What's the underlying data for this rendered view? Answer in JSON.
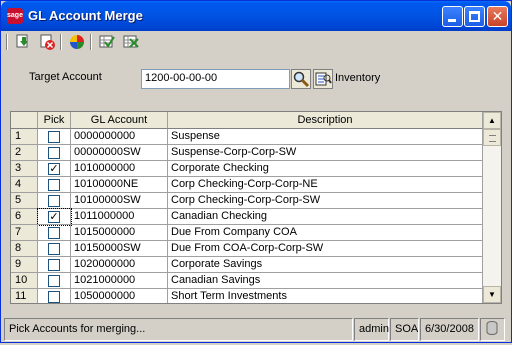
{
  "window": {
    "title": "GL Account Merge",
    "app_icon_text": "sage",
    "close_glyph": "✕"
  },
  "toolbar": {
    "icons": [
      "import-icon",
      "delete-icon",
      "color-wheel-icon",
      "grid-check-icon",
      "grid-x-icon"
    ]
  },
  "form": {
    "target_account_label": "Target Account",
    "target_account_value": "1200-00-00-00",
    "target_account_description": "Inventory"
  },
  "grid": {
    "headers": {
      "row": "",
      "pick": "Pick",
      "account": "GL Account",
      "description": "Description"
    },
    "check_glyph": "✓",
    "rows": [
      {
        "num": "1",
        "picked": false,
        "account": "0000000000",
        "description": "Suspense"
      },
      {
        "num": "2",
        "picked": false,
        "account": "00000000SW",
        "description": "Suspense-Corp-Corp-SW"
      },
      {
        "num": "3",
        "picked": true,
        "account": "1010000000",
        "description": "Corporate Checking"
      },
      {
        "num": "4",
        "picked": false,
        "account": "10100000NE",
        "description": "Corp Checking-Corp-Corp-NE"
      },
      {
        "num": "5",
        "picked": false,
        "account": "10100000SW",
        "description": "Corp Checking-Corp-Corp-SW"
      },
      {
        "num": "6",
        "picked": true,
        "account": "1011000000",
        "description": "Canadian Checking"
      },
      {
        "num": "7",
        "picked": false,
        "account": "1015000000",
        "description": "Due From Company COA"
      },
      {
        "num": "8",
        "picked": false,
        "account": "10150000SW",
        "description": "Due From COA-Corp-Corp-SW"
      },
      {
        "num": "9",
        "picked": false,
        "account": "1020000000",
        "description": "Corporate Savings"
      },
      {
        "num": "10",
        "picked": false,
        "account": "1021000000",
        "description": "Canadian Savings"
      },
      {
        "num": "11",
        "picked": false,
        "account": "1050000000",
        "description": "Short Term Investments"
      }
    ],
    "scroll_up_glyph": "▲",
    "scroll_down_glyph": "▼"
  },
  "status": {
    "message": "Pick Accounts for merging...",
    "user": "admin",
    "company": "SOA",
    "date": "6/30/2008"
  },
  "colors": {
    "titlebar": "#0055e5",
    "face": "#d4d0c8",
    "sage_red": "#c8102e"
  }
}
